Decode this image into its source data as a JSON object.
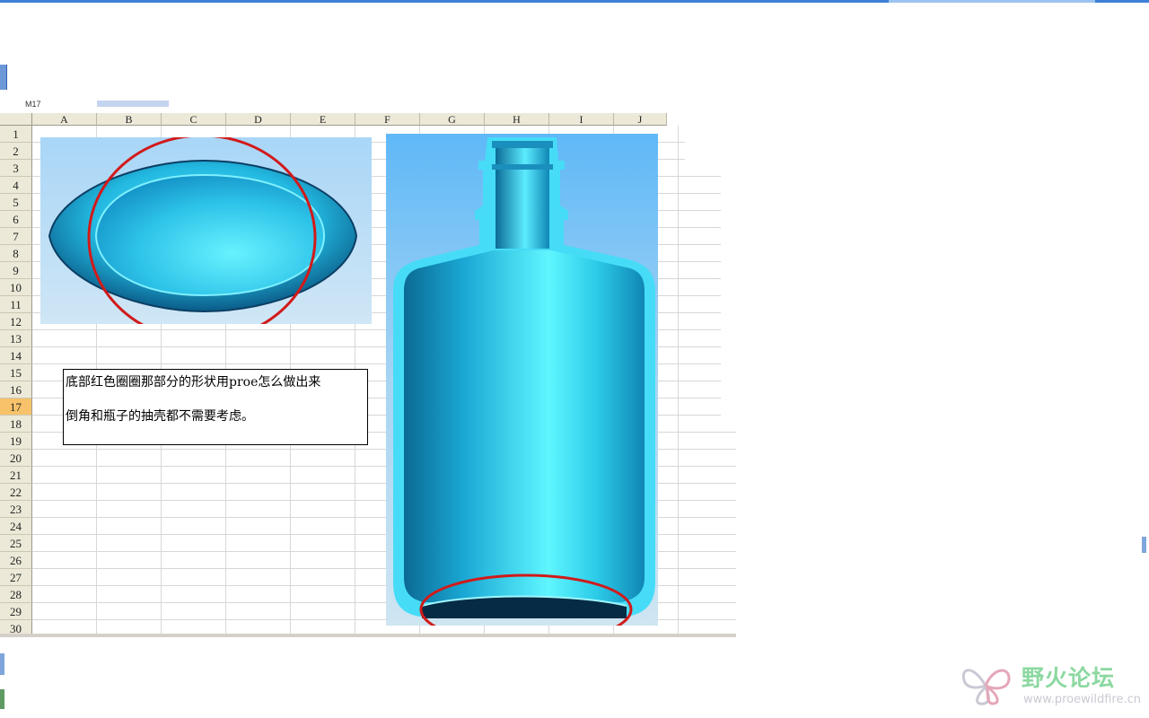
{
  "spreadsheet": {
    "name_box": "M17",
    "columns": [
      "A",
      "B",
      "C",
      "D",
      "E",
      "F",
      "G",
      "H",
      "I",
      "J"
    ],
    "rows": [
      "1",
      "2",
      "3",
      "4",
      "5",
      "6",
      "7",
      "8",
      "9",
      "10",
      "11",
      "12",
      "13",
      "14",
      "15",
      "16",
      "17",
      "18",
      "19",
      "20",
      "21",
      "22",
      "23",
      "24",
      "25",
      "26",
      "27",
      "28",
      "29",
      "30"
    ],
    "active_row": "17"
  },
  "textbox": {
    "line1": "底部红色圈圈那部分的形状用proe怎么做出来",
    "line2": "倒角和瓶子的抽壳都不需要考虑。"
  },
  "images": {
    "top_view": "bottle-top-view-image",
    "front_view": "bottle-front-view-image"
  },
  "watermark": {
    "title": "野火论坛",
    "url": "www.proewildfire.cn"
  },
  "colors": {
    "annotation_circle": "#d11a1a",
    "bottle_cyan": "#33d6f2",
    "row_highlight": "#f7c26a",
    "sheet_header": "#ece9d8"
  }
}
